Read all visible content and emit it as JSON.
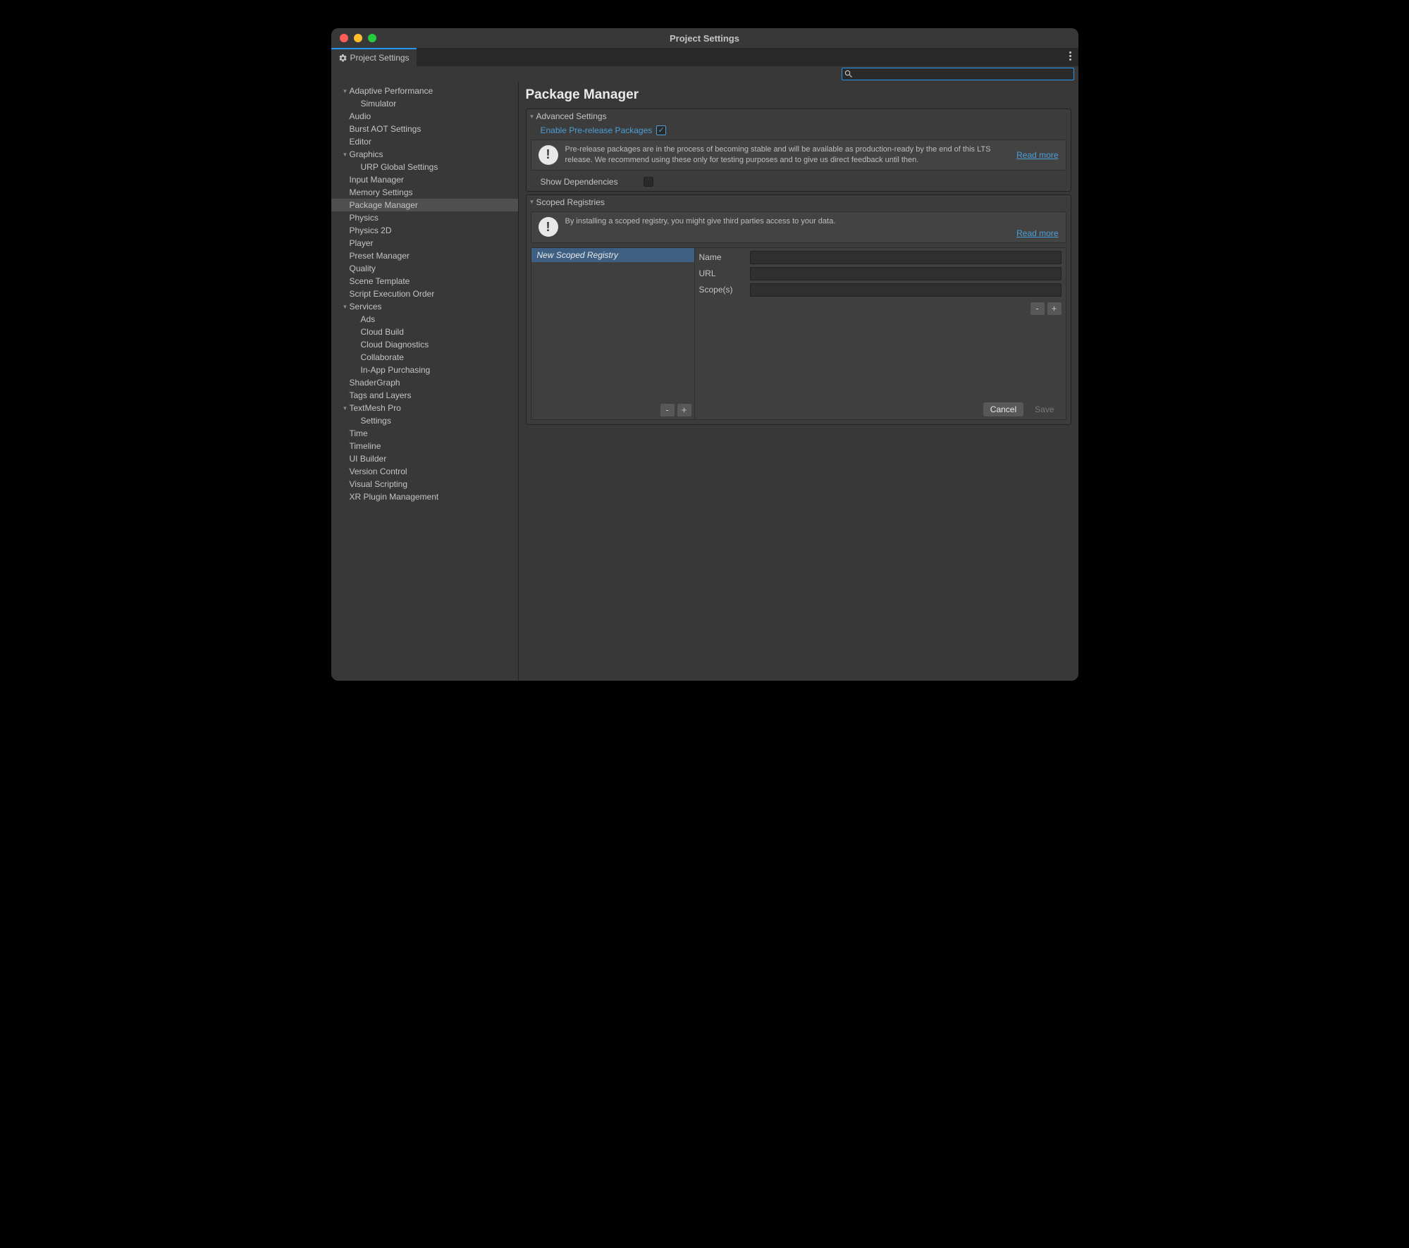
{
  "window": {
    "title": "Project Settings"
  },
  "tab": {
    "label": "Project Settings"
  },
  "search": {
    "value": ""
  },
  "sidebar": {
    "items": [
      {
        "label": "Adaptive Performance",
        "indent": 1,
        "arrow": true
      },
      {
        "label": "Simulator",
        "indent": 2,
        "arrow": false
      },
      {
        "label": "Audio",
        "indent": 1,
        "arrow": false
      },
      {
        "label": "Burst AOT Settings",
        "indent": 1,
        "arrow": false
      },
      {
        "label": "Editor",
        "indent": 1,
        "arrow": false
      },
      {
        "label": "Graphics",
        "indent": 1,
        "arrow": true
      },
      {
        "label": "URP Global Settings",
        "indent": 2,
        "arrow": false
      },
      {
        "label": "Input Manager",
        "indent": 1,
        "arrow": false
      },
      {
        "label": "Memory Settings",
        "indent": 1,
        "arrow": false
      },
      {
        "label": "Package Manager",
        "indent": 1,
        "arrow": false,
        "selected": true
      },
      {
        "label": "Physics",
        "indent": 1,
        "arrow": false
      },
      {
        "label": "Physics 2D",
        "indent": 1,
        "arrow": false
      },
      {
        "label": "Player",
        "indent": 1,
        "arrow": false
      },
      {
        "label": "Preset Manager",
        "indent": 1,
        "arrow": false
      },
      {
        "label": "Quality",
        "indent": 1,
        "arrow": false
      },
      {
        "label": "Scene Template",
        "indent": 1,
        "arrow": false
      },
      {
        "label": "Script Execution Order",
        "indent": 1,
        "arrow": false
      },
      {
        "label": "Services",
        "indent": 1,
        "arrow": true
      },
      {
        "label": "Ads",
        "indent": 2,
        "arrow": false
      },
      {
        "label": "Cloud Build",
        "indent": 2,
        "arrow": false
      },
      {
        "label": "Cloud Diagnostics",
        "indent": 2,
        "arrow": false
      },
      {
        "label": "Collaborate",
        "indent": 2,
        "arrow": false
      },
      {
        "label": "In-App Purchasing",
        "indent": 2,
        "arrow": false
      },
      {
        "label": "ShaderGraph",
        "indent": 1,
        "arrow": false
      },
      {
        "label": "Tags and Layers",
        "indent": 1,
        "arrow": false
      },
      {
        "label": "TextMesh Pro",
        "indent": 1,
        "arrow": true
      },
      {
        "label": "Settings",
        "indent": 2,
        "arrow": false
      },
      {
        "label": "Time",
        "indent": 1,
        "arrow": false
      },
      {
        "label": "Timeline",
        "indent": 1,
        "arrow": false
      },
      {
        "label": "UI Builder",
        "indent": 1,
        "arrow": false
      },
      {
        "label": "Version Control",
        "indent": 1,
        "arrow": false
      },
      {
        "label": "Visual Scripting",
        "indent": 1,
        "arrow": false
      },
      {
        "label": "XR Plugin Management",
        "indent": 1,
        "arrow": false
      }
    ]
  },
  "main": {
    "title": "Package Manager",
    "advanced": {
      "header": "Advanced Settings",
      "enable_prerelease_label": "Enable Pre-release Packages",
      "enable_prerelease_checked": true,
      "info_text": "Pre-release packages are in the process of becoming stable and will be available as production-ready by the end of this LTS release. We recommend using these only for testing purposes and to give us direct feedback until then.",
      "read_more": "Read more",
      "show_deps_label": "Show Dependencies",
      "show_deps_checked": false
    },
    "scoped": {
      "header": "Scoped Registries",
      "info_text": "By installing a scoped registry, you might give third parties access to your data.",
      "read_more": "Read more",
      "entry": "New Scoped Registry",
      "name_label": "Name",
      "name_value": "",
      "url_label": "URL",
      "url_value": "",
      "scope_label": "Scope(s)",
      "scope_value": "",
      "minus": "-",
      "plus": "+",
      "cancel": "Cancel",
      "save": "Save"
    }
  }
}
